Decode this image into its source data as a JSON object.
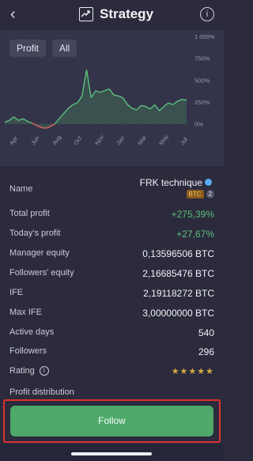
{
  "header": {
    "title": "Strategy",
    "back_icon": "chevron-left-icon",
    "title_icon": "chart-trend-icon",
    "info_icon": "info-icon"
  },
  "filters": {
    "profit": "Profit",
    "all": "All"
  },
  "chart_data": {
    "type": "line",
    "x_ticks": [
      "Apr",
      "Jun",
      "Aug",
      "Oct",
      "Nov",
      "Jan",
      "Mar",
      "May",
      "Jul"
    ],
    "y_ticks": [
      "1 000%",
      "750%",
      "500%",
      "250%",
      "0%"
    ],
    "ylim": [
      0,
      1000
    ],
    "series": [
      {
        "color": "#5dc07a",
        "x": [
          0,
          1,
          2,
          3,
          4,
          5,
          6,
          7,
          8,
          9,
          10,
          11,
          12,
          13,
          14,
          15,
          16,
          17,
          18,
          19,
          20,
          21,
          22,
          23,
          24,
          25,
          26,
          27,
          28,
          29,
          30,
          31,
          32,
          33,
          34,
          35,
          36,
          37,
          38,
          39,
          40
        ],
        "values": [
          20,
          40,
          80,
          40,
          60,
          30,
          10,
          -20,
          -40,
          -50,
          -30,
          0,
          60,
          120,
          180,
          220,
          240,
          320,
          620,
          300,
          380,
          360,
          380,
          400,
          330,
          320,
          300,
          220,
          180,
          160,
          210,
          200,
          170,
          220,
          150,
          200,
          240,
          220,
          260,
          280,
          270
        ]
      }
    ],
    "negative_color": "#e2665c",
    "grid": true
  },
  "rows": {
    "name_label": "Name",
    "name_value": "FRK technique",
    "badge_btc": "BTC",
    "badge_count": "2",
    "total_profit_label": "Total profit",
    "total_profit_value": "+275,39%",
    "todays_profit_label": "Today's profit",
    "todays_profit_value": "+27,67%",
    "manager_equity_label": "Manager equity",
    "manager_equity_value": "0,13596506 BTC",
    "followers_equity_label": "Followers' equity",
    "followers_equity_value": "2,16685476 BTC",
    "ife_label": "IFE",
    "ife_value": "2,19118272 BTC",
    "max_ife_label": "Max IFE",
    "max_ife_value": "3,00000000 BTC",
    "active_days_label": "Active days",
    "active_days_value": "540",
    "followers_label": "Followers",
    "followers_value": "296",
    "rating_label": "Rating",
    "rating_stars": "★★★★★",
    "profit_distribution_label": "Profit distribution"
  },
  "follow_button": "Follow"
}
